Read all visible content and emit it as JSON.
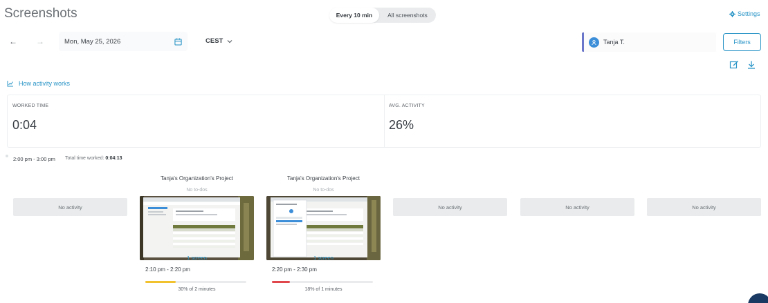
{
  "header": {
    "title": "Screenshots",
    "view_toggle": {
      "active": "Every 10 min",
      "other": "All screenshots"
    },
    "settings_label": "Settings"
  },
  "toolbar": {
    "date": "Mon, May 25, 2026",
    "timezone": "CEST",
    "user": "Tanja T.",
    "filters_label": "Filters",
    "how_activity_label": "How activity works"
  },
  "stats": {
    "worked_label": "WORKED TIME",
    "worked_value": "0:04",
    "activity_label": "AVG. ACTIVITY",
    "activity_value": "26%"
  },
  "hour_block": {
    "range": "2:00 pm - 3:00 pm",
    "total_label": "Total time worked:",
    "total_value": "0:04:13"
  },
  "slots": [
    {
      "type": "empty",
      "label": "No activity"
    },
    {
      "type": "card",
      "project": "Tanja's Organization's Project",
      "todo": "No to-dos",
      "screens": "1 screen",
      "time": "2:10 pm - 2:20 pm",
      "activity_text": "30% of 2 minutes",
      "activity": 0.3,
      "bar_color": "#f2c12e"
    },
    {
      "type": "card",
      "project": "Tanja's Organization's Project",
      "todo": "No to-dos",
      "screens": "1 screen",
      "time": "2:20 pm - 2:30 pm",
      "activity_text": "18% of 1 minutes",
      "activity": 0.18,
      "bar_color": "#e0474c"
    },
    {
      "type": "empty",
      "label": "No activity"
    },
    {
      "type": "empty",
      "label": "No activity"
    },
    {
      "type": "empty",
      "label": "No activity"
    }
  ],
  "colors": {
    "accent": "#2b95c7",
    "user_border": "#6a76c9",
    "avatar": "#3d8ed8"
  }
}
